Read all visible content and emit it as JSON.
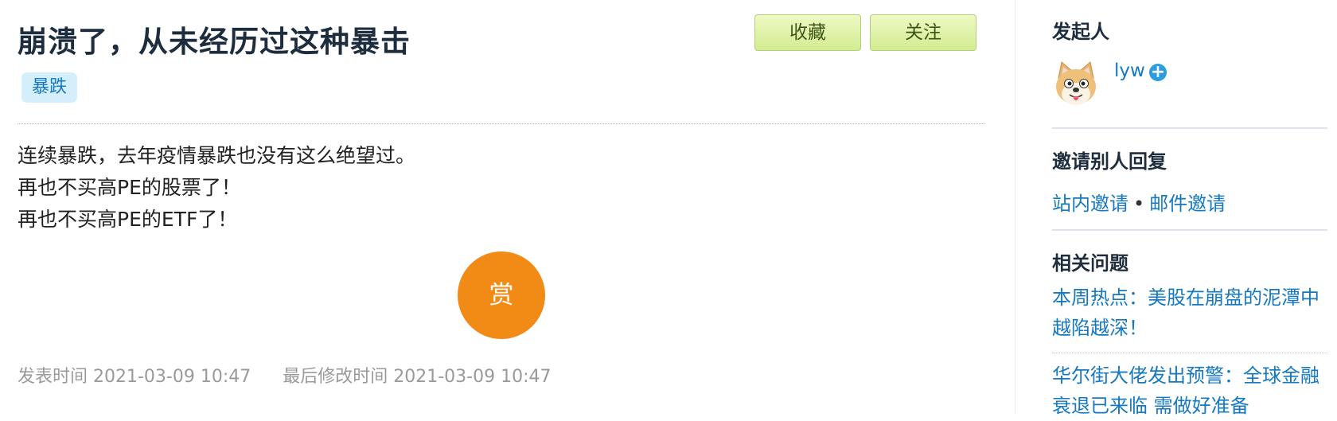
{
  "question": {
    "title": "崩溃了，从未经历过这种暴击",
    "tag": "暴跌",
    "body_lines": [
      "连续暴跌，去年疫情暴跌也没有这么绝望过。",
      "再也不买高PE的股票了！",
      "再也不买高PE的ETF了！"
    ],
    "reward_label": "赏",
    "published_label": "发表时间 2021-03-09 10:47",
    "modified_label": "最后修改时间 2021-03-09 10:47"
  },
  "actions": {
    "favorite_label": "收藏",
    "follow_label": "关注"
  },
  "sidebar": {
    "initiator_heading": "发起人",
    "username": "lyw",
    "avatar_icon": "shiba-dog-avatar-icon",
    "add_icon": "plus-circle-icon",
    "invite_heading": "邀请别人回复",
    "invite_site": "站内邀请",
    "invite_separator": "•",
    "invite_email": "邮件邀请",
    "related_heading": "相关问题",
    "related": [
      "本周热点：美股在崩盘的泥潭中越陷越深！",
      "华尔街大佬发出预警：全球金融衰退已来临 需做好准备"
    ]
  },
  "colors": {
    "link_blue": "#1579c2",
    "reward_orange": "#f28a16",
    "button_green": "#d3ec91",
    "tag_bg": "#d5eefb"
  }
}
